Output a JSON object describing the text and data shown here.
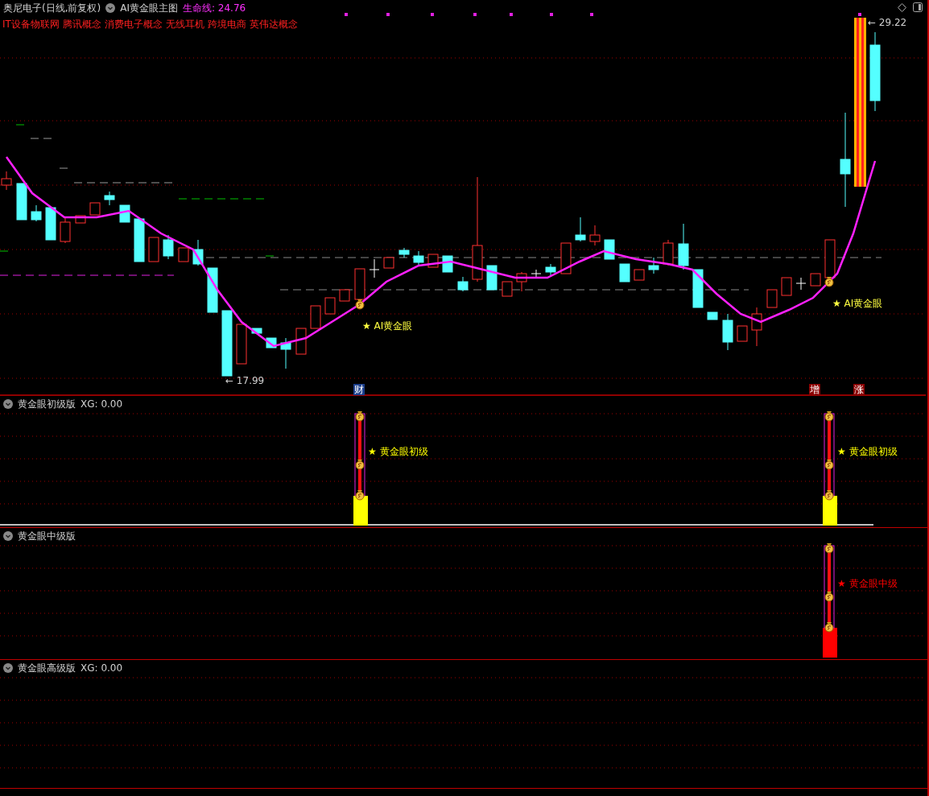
{
  "header": {
    "stock": "奥尼电子(日线,前复权)",
    "indicator": "AI黄金眼主图",
    "lifeline": "生命线: 24.76"
  },
  "concepts": [
    "IT设备物联网",
    "腾讯概念",
    "消费电子概念",
    "无线耳机",
    "跨境电商",
    "英伟达概念"
  ],
  "price_labels": {
    "high": "← 29.22",
    "low": "← 17.99"
  },
  "signals": [
    "★ AI黄金眼",
    "★ AI黄金眼"
  ],
  "event_markers": [
    {
      "label": "财",
      "color": "#1c3f8c"
    },
    {
      "label": "增",
      "color": "#8b0000"
    },
    {
      "label": "涨",
      "color": "#8b0000"
    }
  ],
  "panels": [
    {
      "title": "黄金眼初级版",
      "reading": "XG: 0.00",
      "color": "#ffff00",
      "signals": [
        "★ 黄金眼初级",
        "★ 黄金眼初级"
      ]
    },
    {
      "title": "黄金眼中级版",
      "color": "#ff0000",
      "signals": [
        "★ 黄金眼中级"
      ]
    },
    {
      "title": "黄金眼高级版",
      "reading": "XG: 0.00"
    }
  ]
}
